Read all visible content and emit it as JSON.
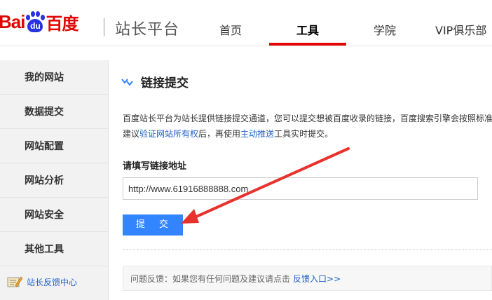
{
  "header": {
    "logo": {
      "latin": "Bai",
      "paw_text": "du",
      "chinese": "百度"
    },
    "site_title": "站长平台",
    "nav": [
      {
        "label": "首页",
        "active": false
      },
      {
        "label": "工具",
        "active": true
      },
      {
        "label": "学院",
        "active": false
      },
      {
        "label": "VIP俱乐部",
        "active": false
      }
    ]
  },
  "sidebar": {
    "items": [
      {
        "label": "我的网站"
      },
      {
        "label": "数据提交"
      },
      {
        "label": "网站配置"
      },
      {
        "label": "网站分析"
      },
      {
        "label": "网站安全"
      },
      {
        "label": "其他工具"
      }
    ],
    "feedback_link": "站长反馈中心"
  },
  "main": {
    "title": "链接提交",
    "desc_line1": "百度站长平台为站长提供链接提交通道，您可以提交想被百度收录的链接，百度搜索引擎会按照标准",
    "desc_line2_pre": "建议",
    "desc_line2_link1": "验证网站所有权",
    "desc_line2_mid": "后，再使用",
    "desc_line2_link2": "主动推送",
    "desc_line2_post": "工具实时提交。",
    "field_label": "请填写链接地址",
    "url_value": "http://www.61916888888.com",
    "submit_label": "提 交",
    "feedback_text": "问题反馈：如果您有任何问题及建议请点击",
    "feedback_link": "反馈入口>>"
  },
  "colors": {
    "brand_red": "#e10602",
    "brand_blue": "#2932e1",
    "button_blue": "#3385ff",
    "link_blue": "#2062c6",
    "arrow_red": "#e8322e"
  }
}
